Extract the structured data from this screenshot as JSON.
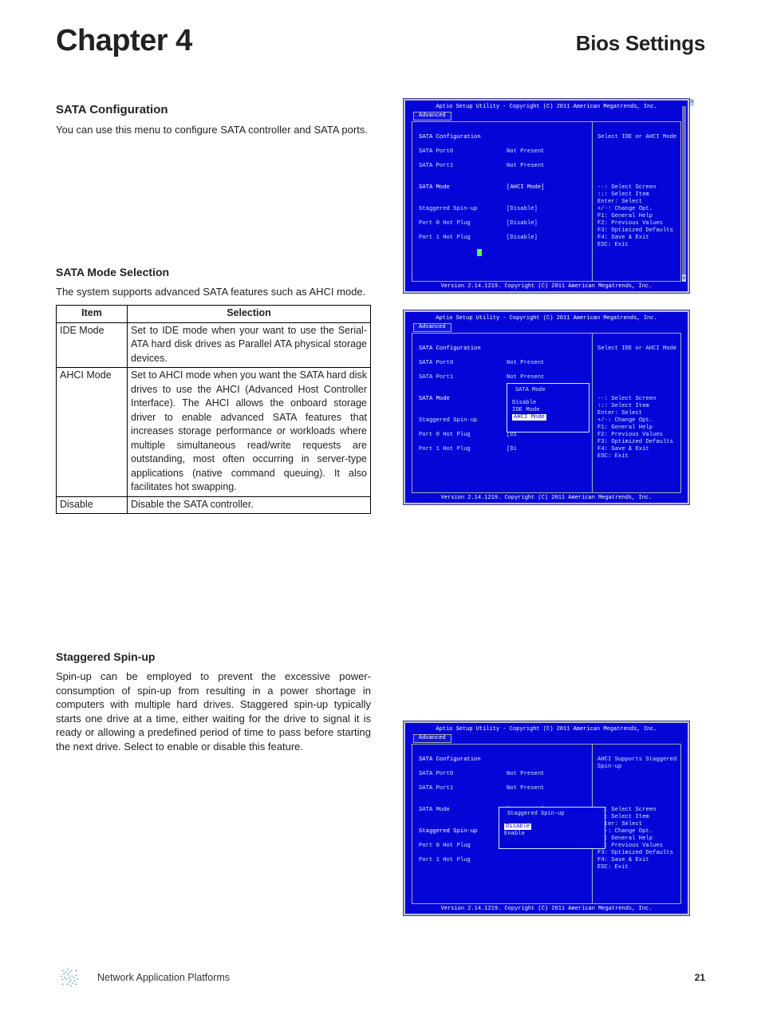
{
  "header": {
    "chapter": "Chapter 4",
    "section": "Bios Settings"
  },
  "sata_config": {
    "heading": "SATA Configuration",
    "body": "You can use this menu to configure SATA controller and SATA ports."
  },
  "sata_mode_sel": {
    "heading": "SATA Mode Selection",
    "body": "The system supports advanced SATA features such as AHCI mode.",
    "table": {
      "col_item": "Item",
      "col_sel": "Selection",
      "rows": [
        {
          "item": "IDE Mode",
          "sel": "Set to IDE mode when your want to use the Serial-ATA hard disk drives as Parallel ATA physical storage devices."
        },
        {
          "item": "AHCI Mode",
          "sel": "Set to AHCI mode when you want the SATA hard disk drives to use the AHCI (Advanced Host Controller Interface). The AHCI allows the onboard storage driver to enable advanced SATA features that increases storage performance or workloads where multiple simultaneous read/write requests are outstanding, most often occurring in server-type applications (native command queuing). It also facilitates hot swapping."
        },
        {
          "item": "Disable",
          "sel": "Disable the SATA controller."
        }
      ]
    }
  },
  "spinup": {
    "heading": "Staggered Spin-up",
    "body": "Spin-up can be employed to prevent the excessive power-consumption of spin-up from resulting in a power shortage in computers with multiple hard drives. Staggered spin-up typically starts one drive at a time, either waiting for the drive to signal it is ready or allowing a predefined period of time to pass before starting the next drive. Select to enable or disable this feature."
  },
  "bios_common": {
    "title_bar": "Aptio Setup Utility - Copyright (C) 2011 American Megatrends, Inc.",
    "tab": "Advanced",
    "version_bar": "Version 2.14.1219. Copyright (C) 2011 American Megatrends, Inc.",
    "section_label": "SATA Configuration",
    "port0_label": "SATA Port0",
    "port1_label": "SATA Port1",
    "not_present": "Not Present",
    "sata_mode_label": "SATA Mode",
    "ahci_mode_val": "[AHCI Mode]",
    "staggered_label": "Staggered Spin-up",
    "p0hot_label": "Port 0 Hot Plug",
    "p1hot_label": "Port 1 Hot Plug",
    "disable_br": "[Disable]",
    "di_prefix": "[Di",
    "help_lines": "--: Select Screen\n↑↓: Select Item\nEnter: Select\n+/-: Change Opt.\nF1: General Help\nF2: Previous Values\nF3: Optimized Defaults\nF4: Save & Exit\nESC: Exit"
  },
  "bios1": {
    "help_top": "Select IDE or AHCI Mode"
  },
  "bios2": {
    "help_top": "Select IDE or AHCI Mode",
    "popup": {
      "title": "SATA Mode",
      "opt1": "Disable",
      "opt2": "IDE Mode",
      "opt3": "AHCI Mode"
    }
  },
  "bios3": {
    "help_top": "AHCI Supports Staggered\nSpin-up",
    "popup": {
      "title": "Staggered Spin-up",
      "opt1": "Disable",
      "opt2": "Enable"
    }
  },
  "footer": {
    "brand": "Network Application Platforms",
    "pagenum": "21"
  }
}
